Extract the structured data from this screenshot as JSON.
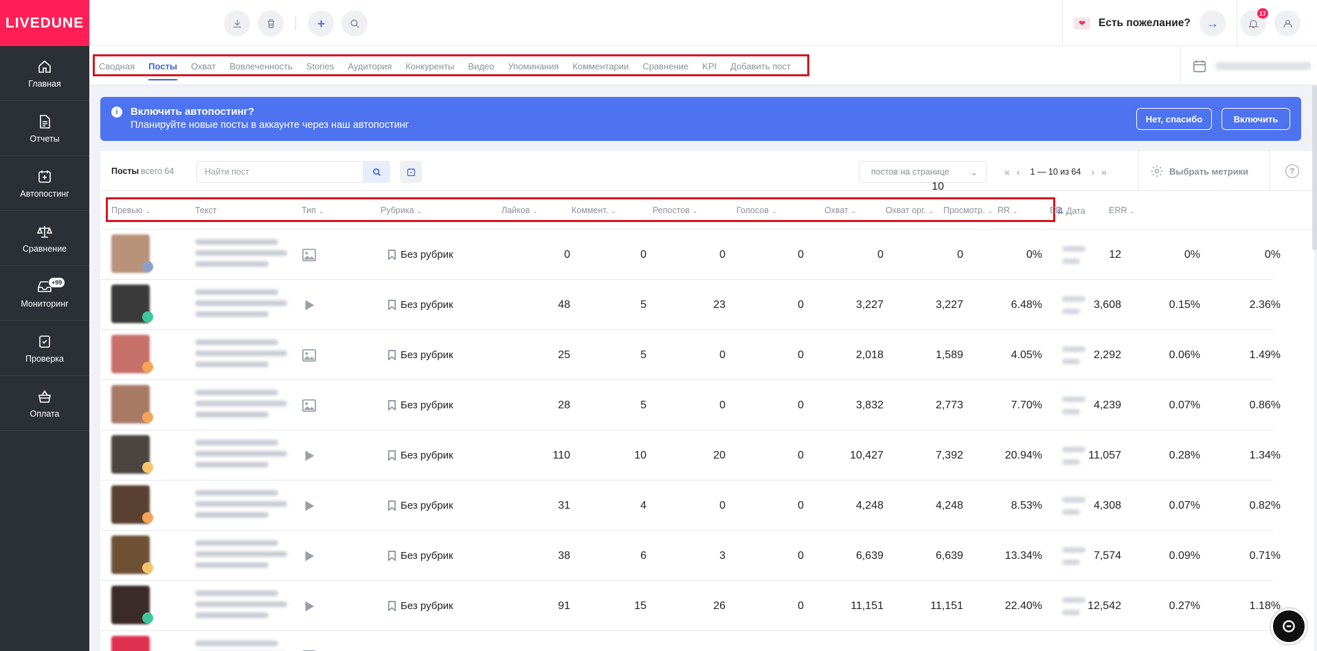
{
  "app": {
    "logo": "LIVEDUNE"
  },
  "sidebar": {
    "items": [
      {
        "label": "Главная",
        "icon": "home-icon"
      },
      {
        "label": "Отчеты",
        "icon": "report-icon"
      },
      {
        "label": "Автопостинг",
        "icon": "calendar-plus-icon"
      },
      {
        "label": "Сравнение",
        "icon": "scales-icon"
      },
      {
        "label": "Мониторинг",
        "icon": "inbox-icon",
        "badge": "+99"
      },
      {
        "label": "Проверка",
        "icon": "shield-check-icon"
      },
      {
        "label": "Оплата",
        "icon": "basket-icon"
      }
    ]
  },
  "header": {
    "wish_label": "Есть пожелание?",
    "notifications_count": "17"
  },
  "tabs": [
    {
      "label": "Сводная"
    },
    {
      "label": "Посты",
      "active": true
    },
    {
      "label": "Охват"
    },
    {
      "label": "Вовлеченность"
    },
    {
      "label": "Stories"
    },
    {
      "label": "Аудитория"
    },
    {
      "label": "Конкуренты"
    },
    {
      "label": "Видео"
    },
    {
      "label": "Упоминания"
    },
    {
      "label": "Комментарии"
    },
    {
      "label": "Сравнение"
    },
    {
      "label": "KPI"
    },
    {
      "label": "Добавить пост"
    }
  ],
  "banner": {
    "title": "Включить автопостинг?",
    "subtitle": "Планируйте новые посты в аккаунте через наш автопостинг",
    "no_label": "Нет, спасибо",
    "yes_label": "Включить"
  },
  "toolbar": {
    "posts_label": "Посты",
    "total_label": "всего 64",
    "search_placeholder": "Найти пост",
    "per_page_num": "10",
    "per_page_label": "постов на странице",
    "range": "1 — 10 из 64",
    "metrics_label": "Выбрать метрики"
  },
  "columns": [
    {
      "label": "Превью",
      "sort": true
    },
    {
      "label": "Текст",
      "sort": false
    },
    {
      "label": "Тип",
      "sort": true
    },
    {
      "label": "Рубрика",
      "sort": true
    },
    {
      "label": "Лайков",
      "sort": true
    },
    {
      "label": "Коммент.",
      "sort": true
    },
    {
      "label": "Репостов",
      "sort": true
    },
    {
      "label": "Голосов",
      "sort": true
    },
    {
      "label": "Охват",
      "sort": true
    },
    {
      "label": "Охват орг.",
      "sort": true
    },
    {
      "label": "RR",
      "sort": true
    },
    {
      "label": "Просмотр.",
      "sort": true
    },
    {
      "label": "ER",
      "sort": true
    },
    {
      "label": "ERR",
      "sort": true
    },
    {
      "label": "Дата",
      "sort": true
    }
  ],
  "rows": [
    {
      "type": "image",
      "thumb": "#b8927a",
      "badge": "#8aa0c8",
      "rubric": "Без рубрик",
      "likes": "0",
      "comments": "0",
      "reposts": "0",
      "votes": "0",
      "reach": "0",
      "reach_org": "0",
      "rr": "0%",
      "views": "12",
      "er": "0%",
      "err": "0%"
    },
    {
      "type": "video",
      "thumb": "#3a3a3a",
      "badge": "#3ec79a",
      "rubric": "Без рубрик",
      "likes": "48",
      "comments": "5",
      "reposts": "23",
      "votes": "0",
      "reach": "3,227",
      "reach_org": "3,227",
      "rr": "6.48%",
      "views": "3,608",
      "er": "0.15%",
      "err": "2.36%"
    },
    {
      "type": "image",
      "thumb": "#c7706a",
      "badge": "#f5a35a",
      "rubric": "Без рубрик",
      "likes": "25",
      "comments": "5",
      "reposts": "0",
      "votes": "0",
      "reach": "2,018",
      "reach_org": "1,589",
      "rr": "4.05%",
      "views": "2,292",
      "er": "0.06%",
      "err": "1.49%"
    },
    {
      "type": "image",
      "thumb": "#a87a66",
      "badge": "#f5a35a",
      "rubric": "Без рубрик",
      "likes": "28",
      "comments": "5",
      "reposts": "0",
      "votes": "0",
      "reach": "3,832",
      "reach_org": "2,773",
      "rr": "7.70%",
      "views": "4,239",
      "er": "0.07%",
      "err": "0.86%"
    },
    {
      "type": "video",
      "thumb": "#4a4540",
      "badge": "#f5c46a",
      "rubric": "Без рубрик",
      "likes": "110",
      "comments": "10",
      "reposts": "20",
      "votes": "0",
      "reach": "10,427",
      "reach_org": "7,392",
      "rr": "20.94%",
      "views": "11,057",
      "er": "0.28%",
      "err": "1.34%"
    },
    {
      "type": "video",
      "thumb": "#5a4030",
      "badge": "#f5a35a",
      "rubric": "Без рубрик",
      "likes": "31",
      "comments": "4",
      "reposts": "0",
      "votes": "0",
      "reach": "4,248",
      "reach_org": "4,248",
      "rr": "8.53%",
      "views": "4,308",
      "er": "0.07%",
      "err": "0.82%"
    },
    {
      "type": "video",
      "thumb": "#6e5035",
      "badge": "#f5c46a",
      "rubric": "Без рубрик",
      "likes": "38",
      "comments": "6",
      "reposts": "3",
      "votes": "0",
      "reach": "6,639",
      "reach_org": "6,639",
      "rr": "13.34%",
      "views": "7,574",
      "er": "0.09%",
      "err": "0.71%"
    },
    {
      "type": "video",
      "thumb": "#3a2a2a",
      "badge": "#3ec79a",
      "rubric": "Без рубрик",
      "likes": "91",
      "comments": "15",
      "reposts": "26",
      "votes": "0",
      "reach": "11,151",
      "reach_org": "11,151",
      "rr": "22.40%",
      "views": "12,542",
      "er": "0.27%",
      "err": "1.18%"
    },
    {
      "type": "image",
      "thumb": "#e03050",
      "badge": "#f5a35a",
      "rubric": "",
      "likes": "",
      "comments": "",
      "reposts": "",
      "votes": "",
      "reach": "",
      "reach_org": "",
      "rr": "",
      "views": "",
      "er": "",
      "err": ""
    }
  ]
}
